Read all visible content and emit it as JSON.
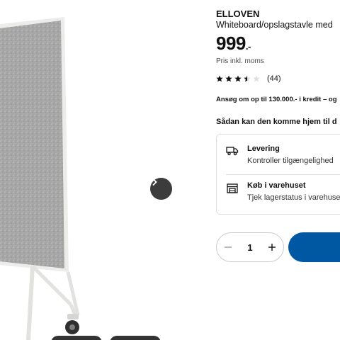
{
  "product": {
    "name": "ELLOVEN",
    "description": "Whiteboard/opslagstavle med",
    "price_main": "999",
    "price_decimal": ".-",
    "vat_note": "Pris inkl. moms",
    "rating_value": 3.5,
    "rating_max": 5,
    "review_count": "(44)",
    "credit_text": "Ansøg om op til 130.000.- i kredit – og"
  },
  "delivery": {
    "heading": "Sådan kan den komme hjem til d",
    "options": [
      {
        "title": "Levering",
        "subtitle": "Kontroller tilgængelighed",
        "icon": "truck-icon"
      },
      {
        "title": "Køb i varehuset",
        "subtitle": "Tjek lagerstatus i varehuset",
        "icon": "store-icon"
      }
    ]
  },
  "quantity": {
    "value": "1"
  },
  "gallery": {
    "next_icon": "chevron-right-icon"
  },
  "colors": {
    "accent": "#0058a3",
    "board": "#a9a9a9",
    "frame": "#e9e9e7"
  }
}
